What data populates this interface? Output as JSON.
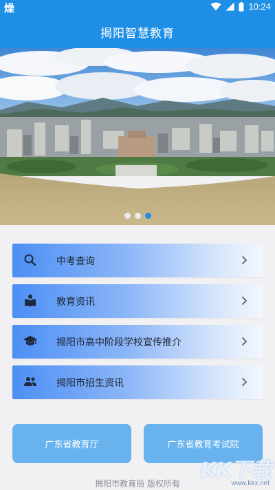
{
  "status_bar": {
    "app_icon_char": "燥",
    "time": "10:24",
    "icons": [
      "wifi-icon",
      "signal-icon",
      "battery-icon"
    ]
  },
  "header": {
    "title": "揭阳智慧教育"
  },
  "banner": {
    "slide_count": 3,
    "active_slide": 3
  },
  "menu": {
    "items": [
      {
        "icon": "search-icon",
        "label": "中考查询"
      },
      {
        "icon": "book-reader-icon",
        "label": "教育资讯"
      },
      {
        "icon": "graduation-cap-icon",
        "label": "揭阳市高中阶段学校宣传推介"
      },
      {
        "icon": "people-icon",
        "label": "揭阳市招生资讯"
      }
    ]
  },
  "links": {
    "left_label": "广东省教育厅",
    "right_label": "广东省教育考试院"
  },
  "footer": {
    "copyright": "揭阳市教育局 版权所有"
  },
  "watermark": {
    "logo": "KK下载",
    "url": "www.kkx.net"
  },
  "colors": {
    "primary": "#1f8fe6",
    "menu_gradient_start": "#4c8ff5",
    "link_button": "#68b3ee",
    "background": "#f1f0f3",
    "dot_active": "#2a8be0"
  }
}
